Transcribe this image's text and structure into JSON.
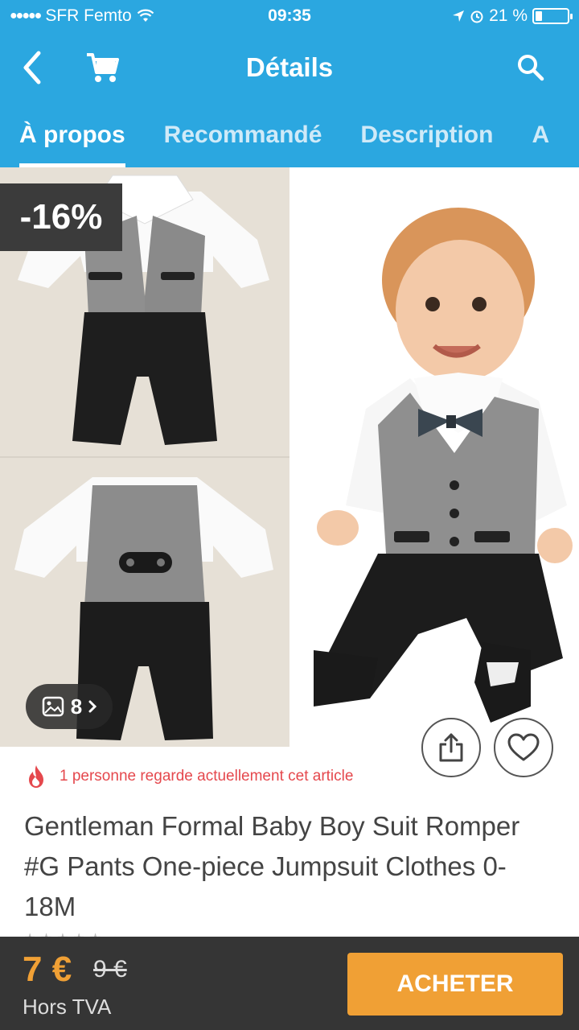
{
  "status_bar": {
    "carrier": "SFR Femto",
    "time": "09:35",
    "battery": "21 %",
    "battery_level": 0.21
  },
  "header": {
    "title": "Détails"
  },
  "tabs": [
    {
      "label": "À propos",
      "active": true
    },
    {
      "label": "Recommandé",
      "active": false
    },
    {
      "label": "Description",
      "active": false
    },
    {
      "label": "A",
      "active": false
    }
  ],
  "gallery": {
    "discount": "-16%",
    "photo_count": "8"
  },
  "watching": {
    "text": "1 personne regarde actuellement cet article"
  },
  "product": {
    "title": "Gentleman Formal Baby Boy Suit Romper #G Pants One-piece Jumpsuit Clothes 0-18M"
  },
  "footer": {
    "price": "7 €",
    "old_price": "9 €",
    "tax_note": "Hors TVA",
    "buy_label": "ACHETER"
  },
  "colors": {
    "brand": "#2ba7e0",
    "accent": "#f0a035",
    "alert": "#e5484d",
    "footer_bg": "#353535"
  }
}
